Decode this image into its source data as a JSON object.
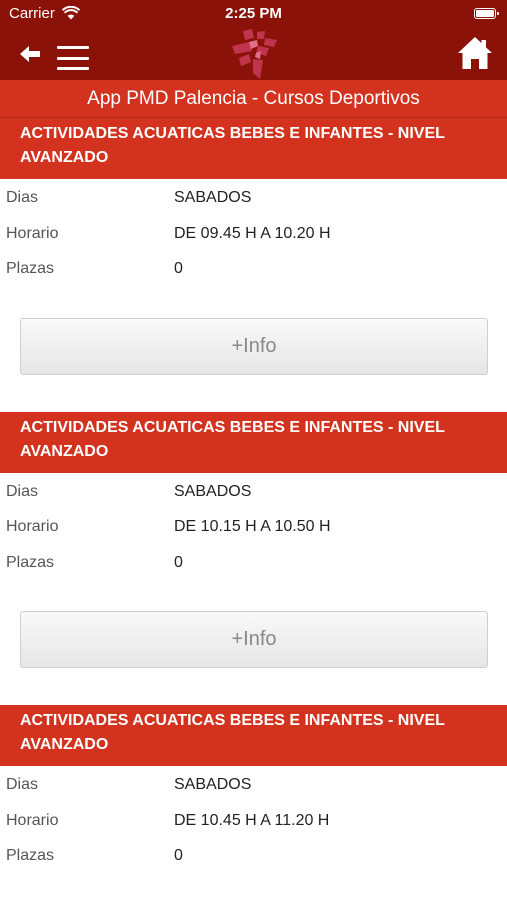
{
  "status_bar": {
    "carrier": "Carrier",
    "time": "2:25 PM"
  },
  "nav": {
    "back_icon": "arrow-left-icon",
    "menu_icon": "hamburger-menu-icon",
    "logo": "pmd-palencia-logo",
    "home_icon": "home-icon"
  },
  "header": {
    "title": "App PMD Palencia - Cursos Deportivos"
  },
  "colors": {
    "nav_dark_red": "#8a1208",
    "header_red": "#d3321f",
    "button_text": "#888888"
  },
  "courses": [
    {
      "title": "ACTIVIDADES ACUATICAS BEBES E INFANTES - NIVEL AVANZADO",
      "dias_label": "Dias",
      "dias": "SABADOS",
      "horario_label": "Horario",
      "horario": "DE 09.45 H A 10.20 H",
      "plazas_label": "Plazas",
      "plazas": "0",
      "button_label": "+Info"
    },
    {
      "title": "ACTIVIDADES ACUATICAS BEBES E INFANTES - NIVEL AVANZADO",
      "dias_label": "Dias",
      "dias": "SABADOS",
      "horario_label": "Horario",
      "horario": "DE 10.15 H A 10.50 H",
      "plazas_label": "Plazas",
      "plazas": "0",
      "button_label": "+Info"
    },
    {
      "title": "ACTIVIDADES ACUATICAS BEBES E INFANTES - NIVEL AVANZADO",
      "dias_label": "Dias",
      "dias": "SABADOS",
      "horario_label": "Horario",
      "horario": "DE 10.45 H A 11.20 H",
      "plazas_label": "Plazas",
      "plazas": "0",
      "button_label": "+Info"
    }
  ]
}
